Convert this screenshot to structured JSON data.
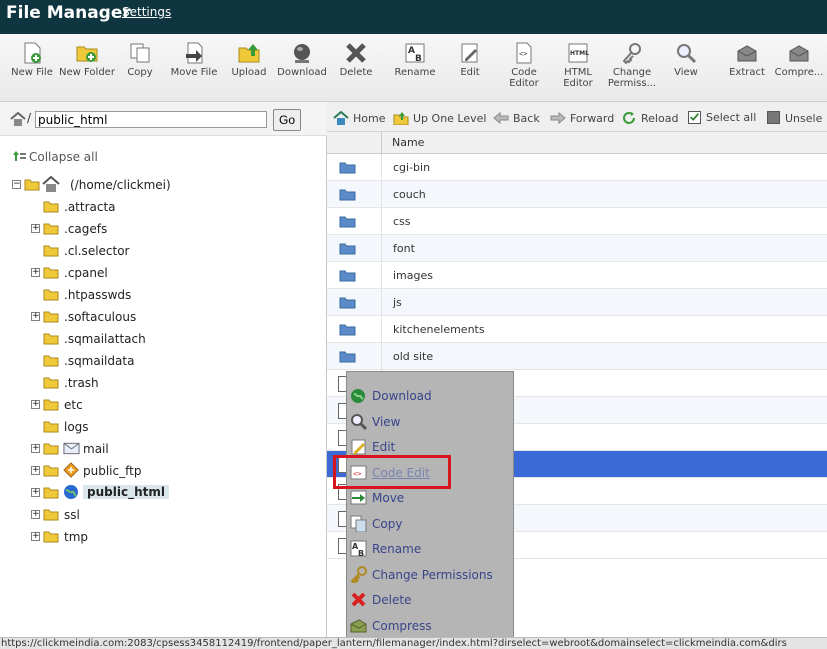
{
  "header": {
    "title": "File Manager",
    "settings_link": "Settings"
  },
  "toolbar": [
    {
      "label": "New File",
      "icon": "new-file-icon"
    },
    {
      "label": "New Folder",
      "icon": "new-folder-icon"
    },
    {
      "label": "Copy",
      "icon": "copy-icon"
    },
    {
      "label": "Move File",
      "icon": "move-file-icon"
    },
    {
      "label": "Upload",
      "icon": "upload-icon"
    },
    {
      "label": "Download",
      "icon": "download-icon"
    },
    {
      "label": "Delete",
      "icon": "delete-icon"
    },
    {
      "label": "Rename",
      "icon": "rename-icon"
    },
    {
      "label": "Edit",
      "icon": "edit-icon"
    },
    {
      "label": "Code Editor",
      "icon": "code-editor-icon"
    },
    {
      "label": "HTML Editor",
      "icon": "html-editor-icon"
    },
    {
      "label": "Change Permiss...",
      "icon": "change-permissions-icon"
    },
    {
      "label": "View",
      "icon": "view-icon"
    },
    {
      "label": "Extract",
      "icon": "extract-icon"
    },
    {
      "label": "Compre...",
      "icon": "compress-icon"
    }
  ],
  "path": {
    "separator": "/",
    "value": "public_html",
    "go_label": "Go"
  },
  "tree": {
    "collapse_all": "Collapse all",
    "root": "(/home/clickmei)",
    "items": [
      {
        "label": ".attracta",
        "expandable": false
      },
      {
        "label": ".cagefs",
        "expandable": true
      },
      {
        "label": ".cl.selector",
        "expandable": false
      },
      {
        "label": ".cpanel",
        "expandable": true
      },
      {
        "label": ".htpasswds",
        "expandable": false
      },
      {
        "label": ".softaculous",
        "expandable": true
      },
      {
        "label": ".sqmailattach",
        "expandable": false
      },
      {
        "label": ".sqmaildata",
        "expandable": false
      },
      {
        "label": ".trash",
        "expandable": false
      },
      {
        "label": "etc",
        "expandable": true
      },
      {
        "label": "logs",
        "expandable": false
      },
      {
        "label": "mail",
        "expandable": true
      },
      {
        "label": "public_ftp",
        "expandable": true
      },
      {
        "label": "public_html",
        "expandable": true
      },
      {
        "label": "ssl",
        "expandable": true
      },
      {
        "label": "tmp",
        "expandable": true
      }
    ]
  },
  "nav": {
    "home": "Home",
    "up": "Up One Level",
    "back": "Back",
    "forward": "Forward",
    "reload": "Reload",
    "select_all": "Select all",
    "unselect": "Unsele"
  },
  "table": {
    "name_header": "Name",
    "folders": [
      "cgi-bin",
      "couch",
      "css",
      "font",
      "images",
      "js",
      "kitchenelements",
      "old site"
    ]
  },
  "context_menu": [
    {
      "label": "Download",
      "icon": "download-globe-icon",
      "disabled": false
    },
    {
      "label": "View",
      "icon": "magnifier-icon",
      "disabled": false
    },
    {
      "label": "Edit",
      "icon": "pencil-icon",
      "disabled": false
    },
    {
      "label": "Code Edit",
      "icon": "code-edit-icon",
      "disabled": true
    },
    {
      "label": "Move",
      "icon": "move-arrow-icon",
      "disabled": false
    },
    {
      "label": "Copy",
      "icon": "copy-pages-icon",
      "disabled": false
    },
    {
      "label": "Rename",
      "icon": "rename-ab-icon",
      "disabled": false
    },
    {
      "label": "Change Permissions",
      "icon": "key-icon",
      "disabled": false
    },
    {
      "label": "Delete",
      "icon": "red-x-icon",
      "disabled": false
    },
    {
      "label": "Compress",
      "icon": "compress-box-icon",
      "disabled": false
    }
  ],
  "status_url": "https://clickmeindia.com:2083/cpsess3458112419/frontend/paper_lantern/filemanager/index.html?dirselect=webroot&domainselect=clickmeindia.com&dirs"
}
